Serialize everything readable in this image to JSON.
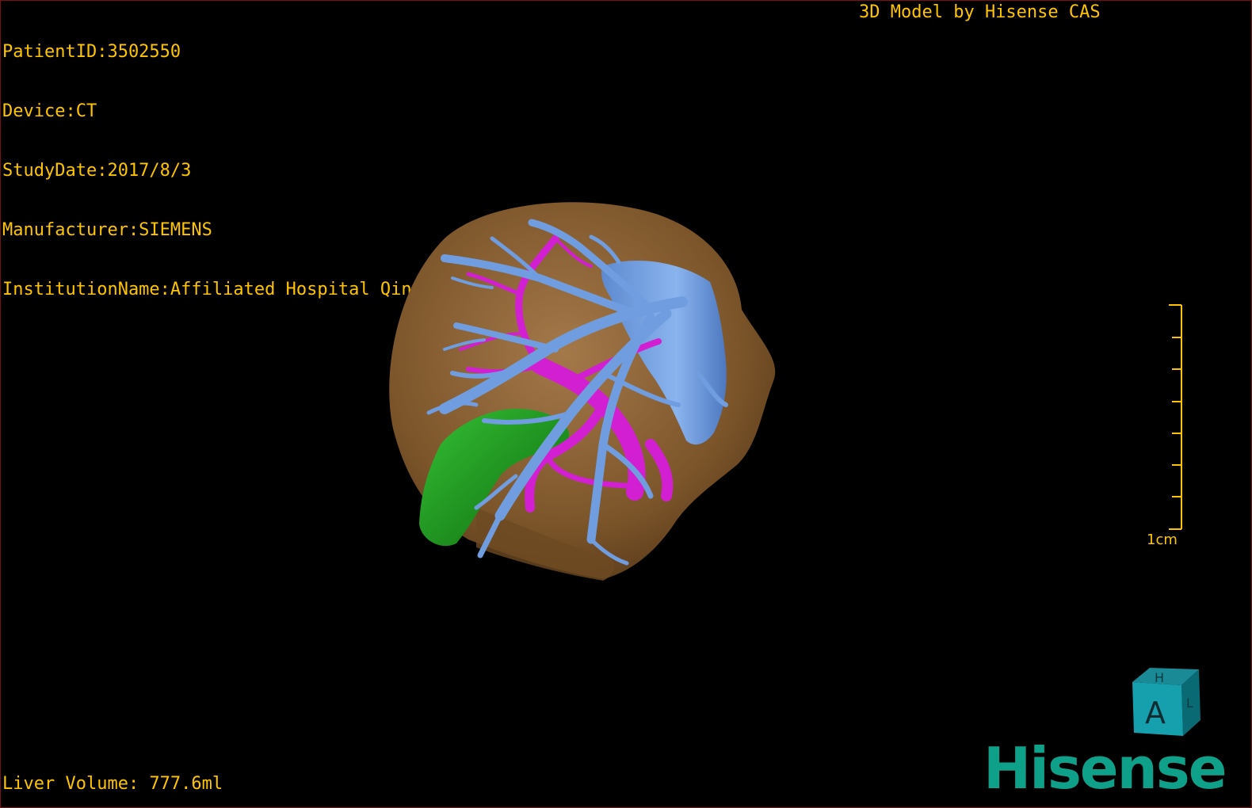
{
  "info": {
    "patient_id": "PatientID:3502550",
    "device": "Device:CT",
    "study_date": "StudyDate:2017/8/3",
    "manufacturer": "Manufacturer:SIEMENS",
    "institution": "InstitutionName:Affiliated Hospital Qingdao University-C"
  },
  "credit": "3D Model by Hisense CAS",
  "liver_volume": "Liver Volume: 777.6ml",
  "scale": {
    "label": "1cm",
    "tick_count": 8
  },
  "orientation_cube": {
    "front": "A",
    "top": "H",
    "side": "L"
  },
  "brand": {
    "logo_text": "Hisense",
    "color": "#0fa08a"
  },
  "colors": {
    "text": "#ffc400",
    "liver": "#8a6132",
    "hepatic_vein": "#6f9de0",
    "portal_vein": "#d21fd2",
    "gallbladder": "#1f9a1f",
    "border": "#7a1010"
  }
}
